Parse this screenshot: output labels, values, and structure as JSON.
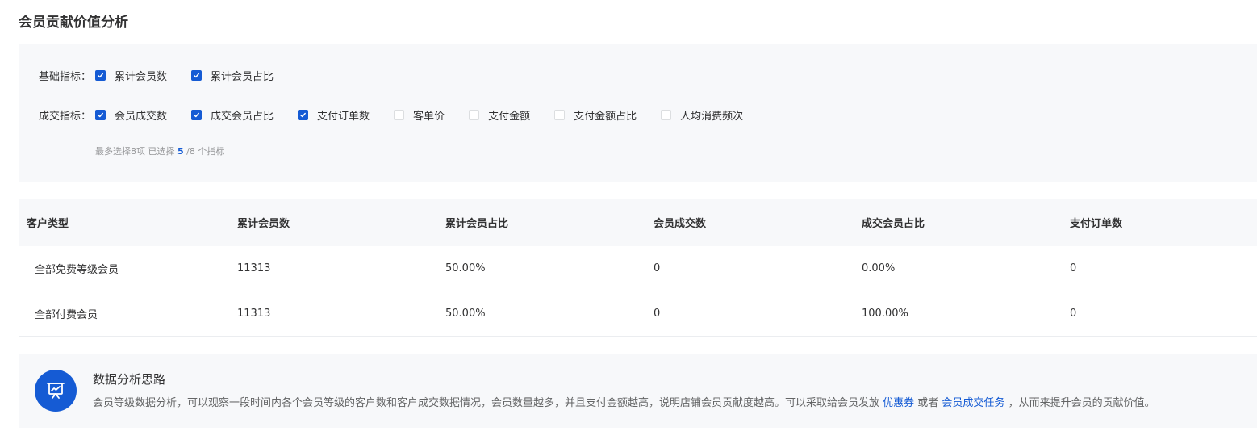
{
  "title": "会员贡献价值分析",
  "filters": {
    "basic": {
      "label": "基础指标：",
      "items": [
        {
          "label": "累计会员数",
          "checked": true
        },
        {
          "label": "累计会员占比",
          "checked": true
        }
      ]
    },
    "deal": {
      "label": "成交指标：",
      "items": [
        {
          "label": "会员成交数",
          "checked": true
        },
        {
          "label": "成交会员占比",
          "checked": true
        },
        {
          "label": "支付订单数",
          "checked": true
        },
        {
          "label": "客单价",
          "checked": false
        },
        {
          "label": "支付金额",
          "checked": false
        },
        {
          "label": "支付金额占比",
          "checked": false
        },
        {
          "label": "人均消费频次",
          "checked": false
        }
      ]
    },
    "hint": {
      "prefix": "最多选择8项 已选择 ",
      "selected": "5",
      "suffix": " /8 个指标"
    }
  },
  "table": {
    "columns": [
      "客户类型",
      "累计会员数",
      "累计会员占比",
      "会员成交数",
      "成交会员占比",
      "支付订单数"
    ],
    "rows": [
      [
        "全部免费等级会员",
        "11313",
        "50.00%",
        "0",
        "0.00%",
        "0"
      ],
      [
        "全部付费会员",
        "11313",
        "50.00%",
        "0",
        "100.00%",
        "0"
      ]
    ]
  },
  "tip": {
    "icon": "presentation-chart-icon",
    "title": "数据分析思路",
    "text_before": "会员等级数据分析，可以观察一段时间内各个会员等级的客户数和客户成交数据情况，会员数量越多，并且支付金额越高，说明店铺会员贡献度越高。可以采取给会员发放 ",
    "link1": "优惠券",
    "text_middle": " 或者 ",
    "link2": "会员成交任务",
    "text_after": " ，从而来提升会员的贡献价值。"
  },
  "colors": {
    "accent": "#155bd4",
    "panel_bg": "#f7f8fa",
    "divider": "#ebedf0"
  }
}
